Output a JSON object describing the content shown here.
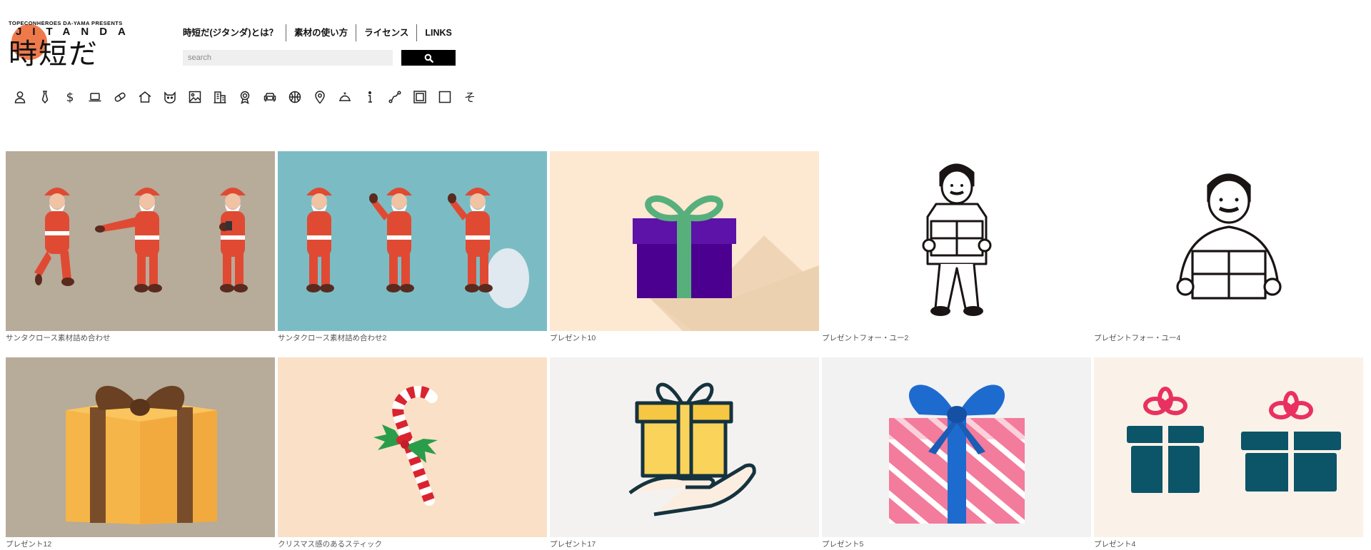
{
  "logo": {
    "presents": "TOPECONHEROES DA-YAMA PRESENTS",
    "brand": "JITANDA",
    "kanji": "時短だ"
  },
  "nav": {
    "items": [
      {
        "label": "時短だ(ジタンダ)とは？"
      },
      {
        "label": "素材の使い方"
      },
      {
        "label": "ライセンス"
      },
      {
        "label": "LINKS"
      }
    ]
  },
  "search": {
    "placeholder": "search",
    "value": "",
    "button_icon": "search-icon"
  },
  "categories": [
    {
      "icon": "person-icon"
    },
    {
      "icon": "necktie-icon"
    },
    {
      "icon": "dollar-icon"
    },
    {
      "icon": "laptop-icon"
    },
    {
      "icon": "pill-icon"
    },
    {
      "icon": "house-icon"
    },
    {
      "icon": "cat-icon"
    },
    {
      "icon": "picture-icon"
    },
    {
      "icon": "building-icon"
    },
    {
      "icon": "medal-icon"
    },
    {
      "icon": "car-icon"
    },
    {
      "icon": "basketball-icon"
    },
    {
      "icon": "map-pin-icon"
    },
    {
      "icon": "food-cover-icon"
    },
    {
      "icon": "info-icon"
    },
    {
      "icon": "route-icon"
    },
    {
      "icon": "frame-icon"
    },
    {
      "icon": "square-icon"
    },
    {
      "icon": "other-icon",
      "glyph": "そ"
    }
  ],
  "gallery": {
    "items": [
      {
        "caption": "サンタクロース素材詰め合わせ",
        "art": "santa-set-1",
        "bg": "#b7ab9a"
      },
      {
        "caption": "サンタクロース素材詰め合わせ2",
        "art": "santa-set-2",
        "bg": "#7bbcc4"
      },
      {
        "caption": "プレゼント10",
        "art": "gift-purple",
        "bg": "#fde8d2"
      },
      {
        "caption": "プレゼントフォー・ユー2",
        "art": "man-holding-gift-standing",
        "bg": "#ffffff"
      },
      {
        "caption": "プレゼントフォー・ユー4",
        "art": "man-holding-gift-bust",
        "bg": "#ffffff"
      },
      {
        "caption": "プレゼント12",
        "art": "gift-box-brown-ribbon",
        "bg": "#b7ab9a"
      },
      {
        "caption": "クリスマス感のあるスティック",
        "art": "candy-cane",
        "bg": "#f9e0c6"
      },
      {
        "caption": "プレゼント17",
        "art": "hand-holding-gift",
        "bg": "#f4f2f0"
      },
      {
        "caption": "プレゼント5",
        "art": "gift-pink-blue",
        "bg": "#f2f2f2"
      },
      {
        "caption": "プレゼント4",
        "art": "two-teal-gifts",
        "bg": "#faf2e8"
      }
    ]
  },
  "colors": {
    "accent_sun": "#ee7a4c",
    "search_button": "#000000",
    "search_field": "#efefef"
  }
}
